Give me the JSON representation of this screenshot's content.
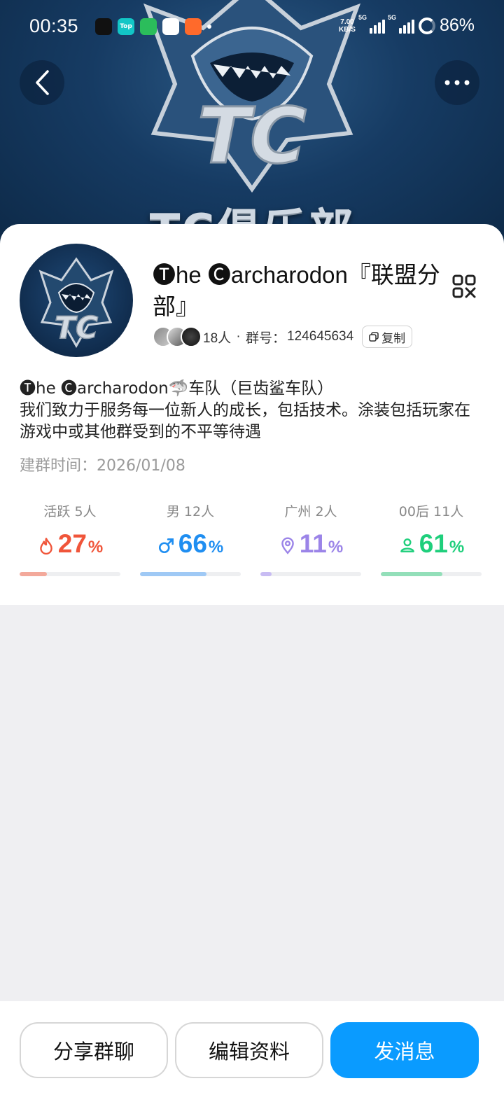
{
  "status_bar": {
    "time": "00:35",
    "app_icons": [
      {
        "name": "tiktok-icon",
        "label": "",
        "color": "#111111"
      },
      {
        "name": "taptap-icon",
        "label": "Top",
        "color": "#12c6c6"
      },
      {
        "name": "shield-app-icon",
        "label": "",
        "color": "#2bbd5b"
      },
      {
        "name": "app-h-icon",
        "label": "",
        "color": "#ffffff"
      },
      {
        "name": "app-orange-icon",
        "label": "",
        "color": "#ff6a2b"
      }
    ],
    "net_speed": "7.00",
    "net_unit": "KB/S",
    "signal_1_label": "5G",
    "signal_2_label": "5G",
    "battery": "86%"
  },
  "hero": {
    "logo_text": "TC俱乐部",
    "back_icon": "chevron-left-icon",
    "more_icon": "more-dots-icon"
  },
  "group": {
    "name": "🅣he 🅒archarodon『联盟分部』",
    "member_count": "18人",
    "separator": " · ",
    "group_id_label": "群号：",
    "group_id": "124645634",
    "copy_label": "复制",
    "description_line1": "🅣he 🅒archarodon🦈车队（巨齿鲨车队）",
    "description_line2": "我们致力于服务每一位新人的成长，包括技术。涂装包括玩家在游戏中或其他群受到的不平等待遇",
    "created_label": "建群时间：",
    "created_date": "2026/01/08"
  },
  "stats": [
    {
      "label": "活跃 5人",
      "value": "27",
      "unit": "%",
      "fraction": 0.27,
      "icon": "flame-icon",
      "color": "#f0553a",
      "fill_color": "#f3a99b"
    },
    {
      "label": "男 12人",
      "value": "66",
      "unit": "%",
      "fraction": 0.66,
      "icon": "male-icon",
      "color": "#1f8ef1",
      "fill_color": "#9fc9f5"
    },
    {
      "label": "广州 2人",
      "value": "11",
      "unit": "%",
      "fraction": 0.11,
      "icon": "location-pin-icon",
      "color": "#9b84e8",
      "fill_color": "#c8bcf3"
    },
    {
      "label": "00后 11人",
      "value": "61",
      "unit": "%",
      "fraction": 0.61,
      "icon": "person-icon",
      "color": "#1fcf7c",
      "fill_color": "#93dfb9"
    }
  ],
  "actions": {
    "share": "分享群聊",
    "edit": "编辑资料",
    "message": "发消息"
  },
  "colors": {
    "primary": "#0a9bff",
    "hero_bg": "#163b63"
  }
}
